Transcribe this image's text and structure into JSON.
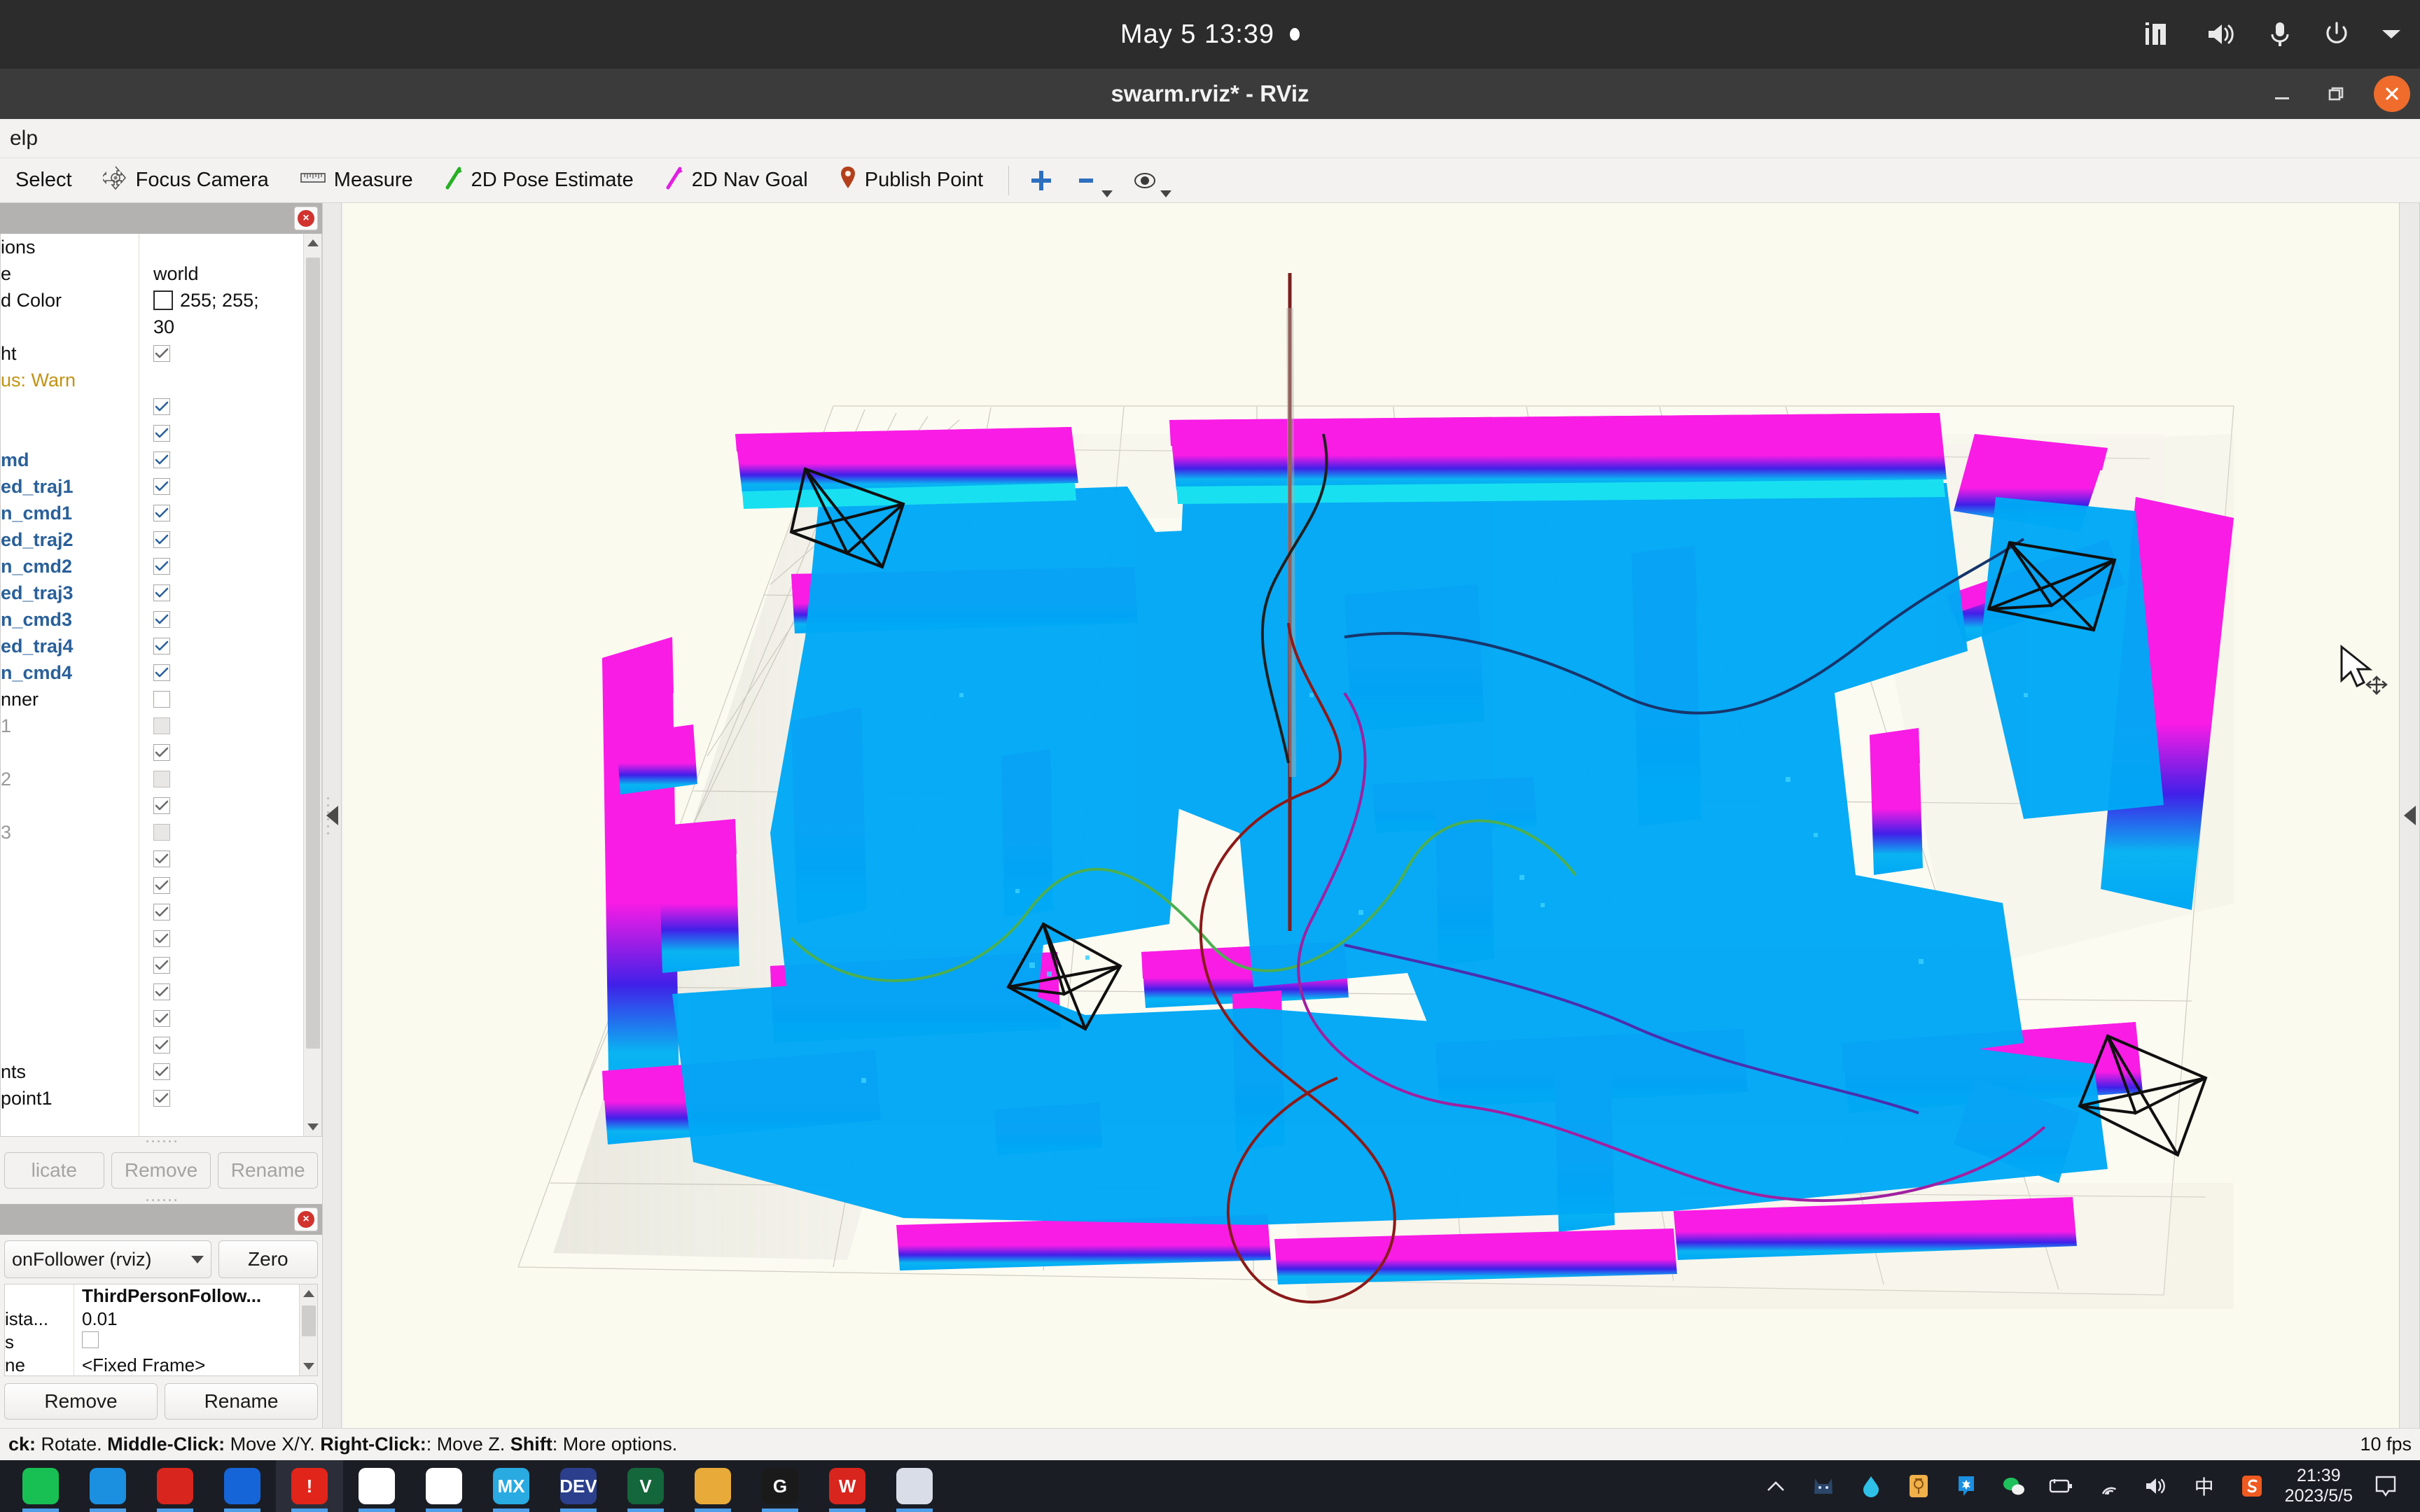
{
  "os_topbar": {
    "clock": "May 5  13:39",
    "tray_icons": [
      "chart-icon",
      "volume-icon",
      "microphone-icon",
      "power-icon",
      "chevron-down-icon"
    ]
  },
  "window": {
    "title": "swarm.rviz* - RViz",
    "buttons": [
      "minimize-button",
      "maximize-button",
      "close-button"
    ]
  },
  "menubar": {
    "items": [
      "elp"
    ]
  },
  "toolbar": {
    "items": [
      {
        "label": "Select",
        "icon": "cursor-select-icon"
      },
      {
        "label": "Focus Camera",
        "icon": "focus-camera-icon"
      },
      {
        "label": "Measure",
        "icon": "ruler-icon"
      },
      {
        "label": "2D Pose Estimate",
        "icon": "green-arrow-icon"
      },
      {
        "label": "2D Nav Goal",
        "icon": "magenta-arrow-icon"
      },
      {
        "label": "Publish Point",
        "icon": "map-pin-icon"
      }
    ],
    "extra_icons": [
      "plus-icon",
      "minus-icon",
      "eye-icon"
    ]
  },
  "displays_panel": {
    "title": "",
    "close_icon": "panel-close-icon",
    "rows": [
      {
        "name": "ions",
        "style": "plain",
        "value": "",
        "widget": "none"
      },
      {
        "name": "e",
        "style": "plain",
        "value": "world",
        "widget": "none"
      },
      {
        "name": "d Color",
        "style": "plain",
        "value": "255; 255;",
        "widget": "swatch"
      },
      {
        "name": "",
        "style": "plain",
        "value": "30",
        "widget": "none"
      },
      {
        "name": "ht",
        "style": "plain",
        "value": "",
        "widget": "check"
      },
      {
        "name": "us: Warn",
        "style": "warn",
        "value": "",
        "widget": "none"
      },
      {
        "name": "",
        "style": "plain",
        "value": "",
        "widget": "check-blue"
      },
      {
        "name": "",
        "style": "plain",
        "value": "",
        "widget": "check-blue"
      },
      {
        "name": "md",
        "style": "blue",
        "value": "",
        "widget": "check-blue"
      },
      {
        "name": "ed_traj1",
        "style": "blue",
        "value": "",
        "widget": "check-blue"
      },
      {
        "name": "n_cmd1",
        "style": "blue",
        "value": "",
        "widget": "check-blue"
      },
      {
        "name": "ed_traj2",
        "style": "blue",
        "value": "",
        "widget": "check-blue"
      },
      {
        "name": "n_cmd2",
        "style": "blue",
        "value": "",
        "widget": "check-blue"
      },
      {
        "name": "ed_traj3",
        "style": "blue",
        "value": "",
        "widget": "check-blue"
      },
      {
        "name": "n_cmd3",
        "style": "blue",
        "value": "",
        "widget": "check-blue"
      },
      {
        "name": "ed_traj4",
        "style": "blue",
        "value": "",
        "widget": "check-blue"
      },
      {
        "name": "n_cmd4",
        "style": "blue",
        "value": "",
        "widget": "check-blue"
      },
      {
        "name": "nner",
        "style": "plain",
        "value": "",
        "widget": "uncheck"
      },
      {
        "name": "1",
        "style": "dim",
        "value": "",
        "widget": "uncheck-disabled"
      },
      {
        "name": "",
        "style": "plain",
        "value": "",
        "widget": "check"
      },
      {
        "name": "2",
        "style": "dim",
        "value": "",
        "widget": "uncheck-disabled"
      },
      {
        "name": "",
        "style": "plain",
        "value": "",
        "widget": "check"
      },
      {
        "name": "3",
        "style": "dim",
        "value": "",
        "widget": "uncheck-disabled"
      },
      {
        "name": "",
        "style": "plain",
        "value": "",
        "widget": "check"
      },
      {
        "name": "",
        "style": "plain",
        "value": "",
        "widget": "check"
      },
      {
        "name": "",
        "style": "plain",
        "value": "",
        "widget": "check"
      },
      {
        "name": "",
        "style": "plain",
        "value": "",
        "widget": "check"
      },
      {
        "name": "",
        "style": "plain",
        "value": "",
        "widget": "check"
      },
      {
        "name": "",
        "style": "plain",
        "value": "",
        "widget": "check"
      },
      {
        "name": "",
        "style": "plain",
        "value": "",
        "widget": "check"
      },
      {
        "name": "",
        "style": "plain",
        "value": "",
        "widget": "check"
      },
      {
        "name": "nts",
        "style": "plain",
        "value": "",
        "widget": "check"
      },
      {
        "name": "point1",
        "style": "plain",
        "value": "",
        "widget": "check"
      }
    ],
    "buttons": {
      "duplicate": "licate",
      "remove": "Remove",
      "rename": "Rename"
    }
  },
  "views_panel": {
    "close_icon": "panel-close-icon",
    "view_type": "onFollower (rviz)",
    "zero_button": "Zero",
    "properties": [
      {
        "name": "",
        "value": "ThirdPersonFollow...",
        "widget": "none",
        "bold": true
      },
      {
        "name": "ista...",
        "value": "0.01",
        "widget": "none",
        "bold": false
      },
      {
        "name": "s",
        "value": "",
        "widget": "uncheck",
        "bold": false
      },
      {
        "name": "ne",
        "value": "<Fixed Frame>",
        "widget": "none",
        "bold": false
      }
    ],
    "buttons": {
      "remove": "Remove",
      "rename": "Rename"
    }
  },
  "statusbar": {
    "hint_prefix": "ck:",
    "hint": " Rotate. ",
    "hint_b1": "Middle-Click:",
    "hint_t1": " Move X/Y. ",
    "hint_b2": "Right-Click:",
    "hint_t2": ": Move Z. ",
    "hint_b3": "Shift",
    "hint_t3": ": More options.",
    "fps": "10 fps"
  },
  "taskbar": {
    "apps": [
      {
        "name": "wechat",
        "color": "#18c054",
        "label": ""
      },
      {
        "name": "qq",
        "color": "#1b8fe0",
        "label": ""
      },
      {
        "name": "netease",
        "color": "#d8251e",
        "label": ""
      },
      {
        "name": "migu",
        "color": "#1565d8",
        "label": ""
      },
      {
        "name": "rviz",
        "color": "#e1251b",
        "label": "!",
        "active": true
      },
      {
        "name": "baidu",
        "color": "#ffffff",
        "label": ""
      },
      {
        "name": "chrome",
        "color": "#ffffff",
        "label": ""
      },
      {
        "name": "mxplayer",
        "color": "#29aae1",
        "label": "MX"
      },
      {
        "name": "devcpp",
        "color": "#2b3f8c",
        "label": "DEV"
      },
      {
        "name": "vscode",
        "color": "#14663b",
        "label": "V"
      },
      {
        "name": "explorer",
        "color": "#e8ab3a",
        "label": ""
      },
      {
        "name": "g-app",
        "color": "#1a1a1a",
        "label": "G"
      },
      {
        "name": "wps",
        "color": "#d8251e",
        "label": "W"
      },
      {
        "name": "swarm-app",
        "color": "#d8dde8",
        "label": ""
      }
    ],
    "tray": [
      "chevron-up-icon",
      "cat-icon",
      "water-drop-icon",
      "orange-badge-icon",
      "qq-icon",
      "wechat-icon",
      "battery-icon",
      "wifi-icon",
      "volume-icon",
      "ime-cn-icon",
      "sogou-icon"
    ],
    "ime_label": "中",
    "clock_time": "21:39",
    "clock_date": "2023/5/5",
    "notification_icon": "notification-icon"
  },
  "viewport": {
    "background_color": "#fbfaee",
    "grid_color": "#c9c6bc",
    "pointcloud_high_color": "#f81ce5",
    "pointcloud_mid_color": "#2e2bdc",
    "pointcloud_low_color": "#00a2f0",
    "floor_color": "#00a8f5",
    "trajectory_colors": [
      "#4caf50",
      "#8b1a1a",
      "#a020a0",
      "#202020",
      "#17356b"
    ],
    "drone_marker_color": "#101010",
    "drone_count": 4,
    "axis_line_color": "#7a1f1f"
  }
}
